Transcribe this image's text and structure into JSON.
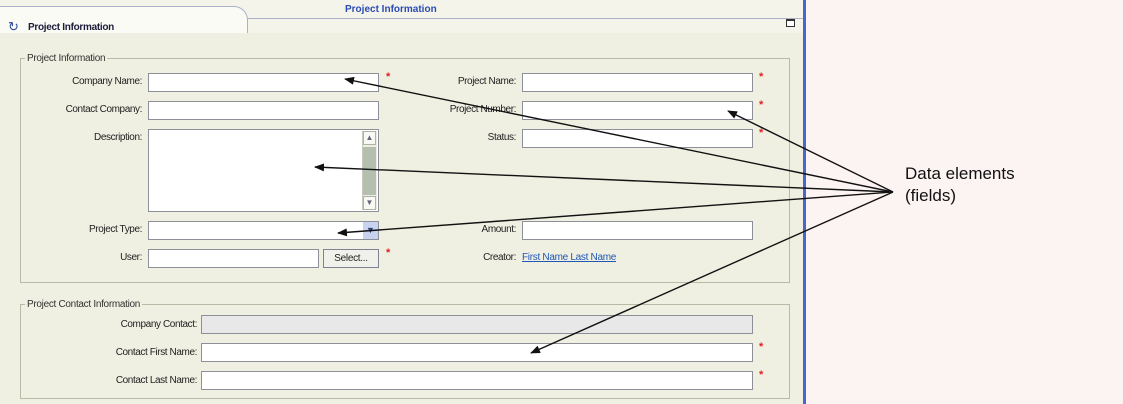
{
  "header": {
    "tab_title": "Project Information",
    "center_title": "Project Information"
  },
  "project_info": {
    "legend": "Project Information",
    "company_name_label": "Company Name:",
    "contact_company_label": "Contact Company:",
    "description_label": "Description:",
    "project_type_label": "Project Type:",
    "user_label": "User:",
    "select_button": "Select...",
    "project_name_label": "Project Name:",
    "project_number_label": "Project Number:",
    "status_label": "Status:",
    "amount_label": "Amount:",
    "creator_label": "Creator:",
    "creator_link": "First Name Last Name",
    "required_mark": "*"
  },
  "project_contact": {
    "legend": "Project Contact Information",
    "company_contact_label": "Company Contact:",
    "first_name_label": "Contact First Name:",
    "last_name_label": "Contact Last Name:"
  },
  "annotation": {
    "line1": "Data elements",
    "line2": "(fields)"
  }
}
